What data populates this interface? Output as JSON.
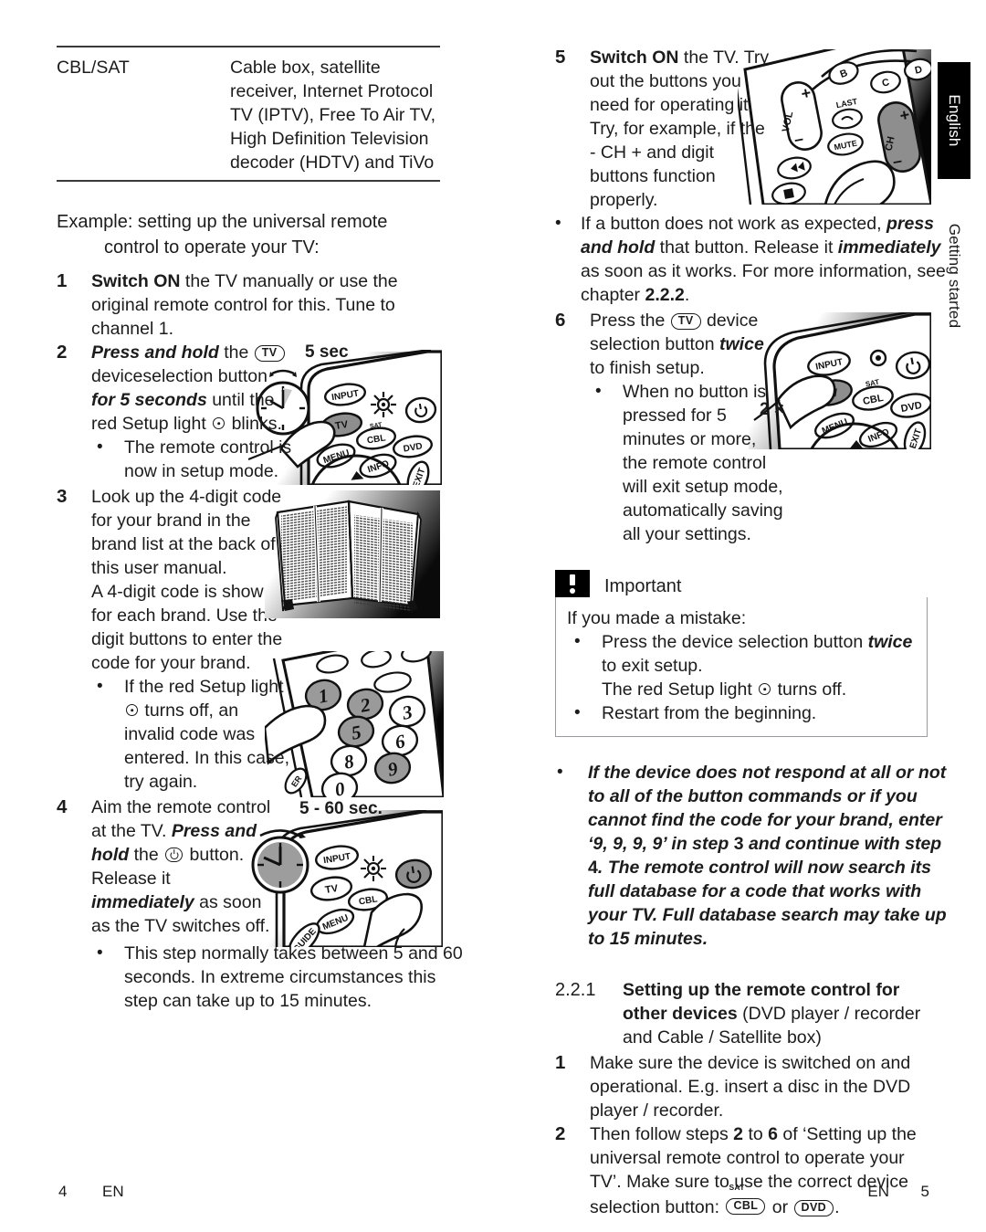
{
  "page": {
    "side_tab": "English",
    "side_section": "Getting started",
    "footer_left_page": "4",
    "footer_left_lang": "EN",
    "footer_right_lang": "EN",
    "footer_right_page": "5"
  },
  "device_table": {
    "name": "CBL/SAT",
    "description": "Cable box, satellite receiver, Internet Protocol TV (IPTV), Free To Air TV, High Definition Television decoder (HDTV) and TiVo"
  },
  "example_heading": {
    "line1": "Example: setting up the universal remote",
    "line2": "control to operate your TV:"
  },
  "steps": {
    "s1": {
      "num": "1",
      "bold": "Switch ON",
      "rest": " the TV manually or use the original remote control for this. Tune to channel 1."
    },
    "s2": {
      "num": "2",
      "p1_bi": "Press and hold",
      "p1_a": " the ",
      "btn": "TV",
      "p1_b": " deviceselection button ",
      "p1_bi2": "for 5 seconds",
      "p1_c": " until the red Setup light ",
      "p1_d": " blinks.",
      "bullet": "The remote control is now in setup mode.",
      "image_caption": "5 sec"
    },
    "s3": {
      "num": "3",
      "p1": "Look up the 4-digit code for your brand in the brand list at the back of this user manual.",
      "p2": "A 4-digit code is shown for each brand. Use the digit buttons to enter the code for your brand.",
      "bullet_a": "If the red Setup light ",
      "bullet_b": " turns off, an invalid code was entered. In this case, try again."
    },
    "s4": {
      "num": "4",
      "p1": "Aim the remote control at the TV. ",
      "p1_bi": "Press and hold",
      "p1_a": " the ",
      "p1_b": " button. Release it ",
      "p1_bi2": "immediately",
      "p1_c": " as soon as the TV switches off.",
      "bullet": "This step normally takes between 5 and 60 seconds. In extreme circumstances this step can take up to 15 minutes.",
      "image_caption": "5 - 60 sec."
    },
    "s5": {
      "num": "5",
      "bold": "Switch ON",
      "p1": " the TV. Try out the buttons you need for operating it. Try, for example, if the - CH + and digit buttons function properly.",
      "bullet_a": "If a button does not work as expected, ",
      "bullet_bi": "press and hold",
      "bullet_b": " that button. Release it ",
      "bullet_bi2": "immediately",
      "bullet_c": " as soon as it works. For more information, see chapter ",
      "bullet_bold": "2.2.2",
      "bullet_d": "."
    },
    "s6": {
      "num": "6",
      "p1": "Press the ",
      "btn": "TV",
      "p1_a": " device selection button ",
      "p1_bi": "twice",
      "p1_b": " to finish setup.",
      "bullet": "When no button is pressed for 5 minutes or more, the remote control will exit setup mode, automatically saving all your settings.",
      "image_caption": "2 ×"
    }
  },
  "important": {
    "title": "Important",
    "intro": "If you made a mistake:",
    "bullet1_a": "Press the device selection button ",
    "bullet1_bi": "twice",
    "bullet1_b": " to exit setup.",
    "bullet1_line2_a": "The red Setup light ",
    "bullet1_line2_b": " turns off.",
    "bullet2": "Restart from the beginning."
  },
  "fulldb_note": {
    "a": "If the device does not respond at all or not to all of the button commands or if you cannot find the code for your brand, enter ‘9, 9, 9, 9’ in step ",
    "b_bold": "3",
    "c": " and continue with step ",
    "d_bold": "4",
    "e": ". The remote control will now search its full database for a code that works with your TV. Full database search may take up to 15 minutes."
  },
  "section_221": {
    "number": "2.2.1",
    "title_bold": "Setting up the remote control for other devices",
    "title_rest": " (DVD player / recorder and Cable / Satellite box)",
    "step1": {
      "num": "1",
      "text": "Make sure the device is switched on and operational. E.g. insert a disc in the DVD player / recorder."
    },
    "step2": {
      "num": "2",
      "a": "Then follow steps ",
      "b_bold": "2",
      "c": " to ",
      "d_bold": "6",
      "e": " of ‘Setting up the universal remote control to operate your TV’. Make sure to use the correct device selection button: ",
      "btn_cbl": "CBL",
      "btn_cbl_sup": "SAT",
      "f": " or ",
      "btn_dvd": "DVD",
      "g": "."
    }
  },
  "illustrations": {
    "remote_step2": {
      "buttons": [
        "INPUT",
        "TV",
        "CBL",
        "SAT",
        "DVD",
        "MENU",
        "INFO",
        "EXIT"
      ],
      "highlight": "TV"
    },
    "keypad_step3": {
      "digits": [
        "1",
        "2",
        "3",
        "5",
        "6",
        "8",
        "9",
        "0"
      ],
      "highlight": [
        "1",
        "2",
        "5",
        "9"
      ]
    },
    "remote_step4": {
      "buttons": [
        "INPUT",
        "TV",
        "CBL",
        "MENU",
        "GUIDE"
      ],
      "highlight": "power"
    },
    "remote_step5": {
      "buttons": [
        "VOL",
        "LAST",
        "MUTE",
        "CH",
        "B",
        "C",
        "D"
      ],
      "highlight": "CH"
    },
    "remote_step6": {
      "buttons": [
        "INPUT",
        "TV",
        "CBL",
        "SAT",
        "DVD",
        "MENU",
        "INFO",
        "EXIT"
      ],
      "highlight": "TV"
    }
  }
}
